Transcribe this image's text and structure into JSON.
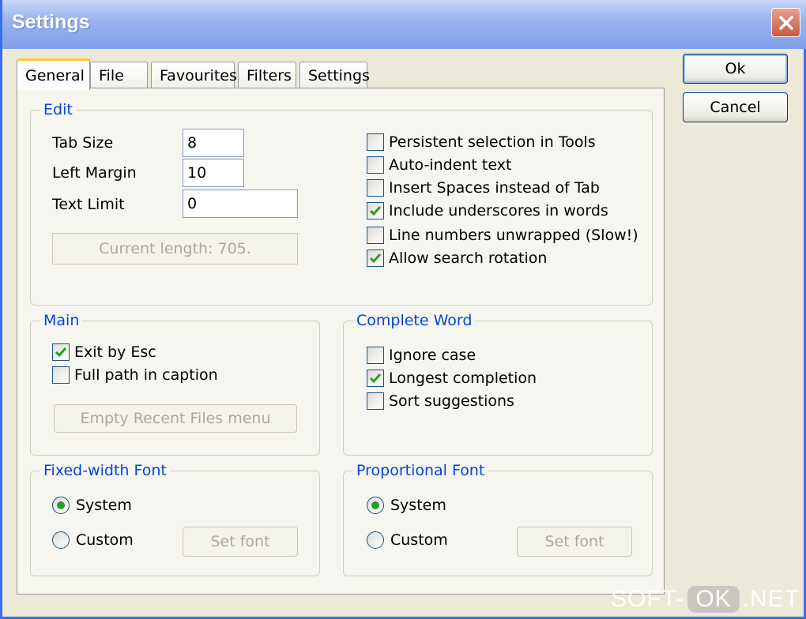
{
  "window": {
    "title": "Settings"
  },
  "buttons": {
    "ok": "Ok",
    "cancel": "Cancel"
  },
  "tabs": [
    {
      "label": "General",
      "active": true
    },
    {
      "label": "File",
      "active": false
    },
    {
      "label": "Favourites",
      "active": false
    },
    {
      "label": "Filters",
      "active": false
    },
    {
      "label": "Settings",
      "active": false
    }
  ],
  "edit": {
    "title": "Edit",
    "tab_size_label": "Tab Size",
    "tab_size_value": "8",
    "left_margin_label": "Left Margin",
    "left_margin_value": "10",
    "text_limit_label": "Text Limit",
    "text_limit_value": "0",
    "current_length": "Current length: 705.",
    "options": [
      {
        "label": "Persistent selection in Tools",
        "checked": false
      },
      {
        "label": "Auto-indent text",
        "checked": false
      },
      {
        "label": "Insert Spaces instead of Tab",
        "checked": false
      },
      {
        "label": "Include underscores in words",
        "checked": true
      },
      {
        "label": "Line numbers unwrapped (Slow!)",
        "checked": false
      },
      {
        "label": "Allow search rotation",
        "checked": true
      }
    ]
  },
  "main": {
    "title": "Main",
    "options": [
      {
        "label": "Exit by Esc",
        "checked": true
      },
      {
        "label": "Full path in caption",
        "checked": false
      }
    ],
    "empty_recent": "Empty Recent Files menu"
  },
  "complete_word": {
    "title": "Complete Word",
    "options": [
      {
        "label": "Ignore case",
        "checked": false
      },
      {
        "label": "Longest completion",
        "checked": true
      },
      {
        "label": "Sort suggestions",
        "checked": false
      }
    ]
  },
  "fixed_font": {
    "title": "Fixed-width Font",
    "system": "System",
    "custom": "Custom",
    "selected": "System",
    "set_font": "Set font"
  },
  "prop_font": {
    "title": "Proportional Font",
    "system": "System",
    "custom": "Custom",
    "selected": "System",
    "set_font": "Set font"
  },
  "watermark": {
    "left": "SOFT-",
    "mid": "OK",
    "right": ".NET"
  },
  "colors": {
    "accent": "#0046d5",
    "check": "#21a121",
    "close": "#c85a44"
  }
}
